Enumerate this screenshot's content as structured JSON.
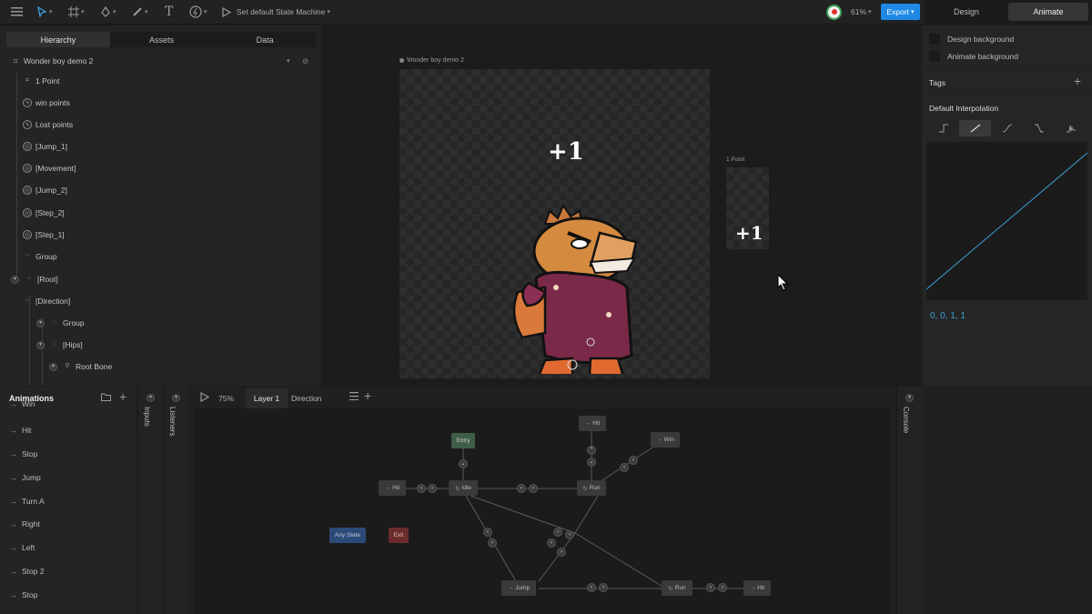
{
  "toolbar": {
    "state_machine_label": "Set default State Machine",
    "zoom": "61%",
    "export_label": "Export",
    "mode_design": "Design",
    "mode_animate": "Animate"
  },
  "left_panel": {
    "tabs": [
      "Hierarchy",
      "Assets",
      "Data"
    ],
    "artboard_name": "Wonder boy demo 2",
    "tree": [
      {
        "label": "1 Point",
        "icon": "artboard-icon"
      },
      {
        "label": "win points",
        "icon": "event-icon"
      },
      {
        "label": "Lost points",
        "icon": "event-icon"
      },
      {
        "label": "[Jump_1]",
        "icon": "target-icon"
      },
      {
        "label": "[Movement]",
        "icon": "target-icon"
      },
      {
        "label": "[Jump_2]",
        "icon": "target-icon"
      },
      {
        "label": "[Step_2]",
        "icon": "target-icon"
      },
      {
        "label": "[Step_1]",
        "icon": "target-icon"
      },
      {
        "label": "Group",
        "icon": "group-icon"
      },
      {
        "label": "[Root]",
        "icon": "group-icon"
      },
      {
        "label": "[Direction]",
        "icon": "group-icon"
      },
      {
        "label": "Group",
        "icon": "node-icon"
      },
      {
        "label": "[Hips]",
        "icon": "node-icon"
      },
      {
        "label": "Root Bone",
        "icon": "bone-icon"
      }
    ]
  },
  "canvas": {
    "artboard_label": "Wonder boy demo 2",
    "plus_text": "+1",
    "point_label": "1 Point",
    "point_plus_text": "+1"
  },
  "right_panel": {
    "design_background": "Design background",
    "animate_background": "Animate background",
    "tags_label": "Tags",
    "interpolation_label": "Default Interpolation",
    "interpolation_values": "0, 0, 1, 1",
    "accent": "#3aa0d8"
  },
  "animations": {
    "title": "Animations",
    "items": [
      "Win",
      "Hit",
      "Stop",
      "Jump",
      "Turn A",
      "Right",
      "Left",
      "Stop 2",
      "Stop"
    ]
  },
  "side_tabs": {
    "inputs": "Inputs",
    "listeners": "Listeners",
    "console": "Console"
  },
  "state_machine": {
    "zoom": "75%",
    "layers": [
      "Layer 1",
      "Direction"
    ],
    "nodes": {
      "entry": "Entry",
      "any_state": "Any State",
      "exit": "Exit",
      "hit1": "Hit",
      "idle": "Idle",
      "hit_top": "Hit",
      "win": "Win",
      "run1": "Run",
      "jump": "Jump",
      "run2": "Run",
      "hit2": "Hit"
    },
    "colors": {
      "entry": "#3f5e4a",
      "any_state": "#2c4a78",
      "exit": "#6a2c2c"
    }
  }
}
